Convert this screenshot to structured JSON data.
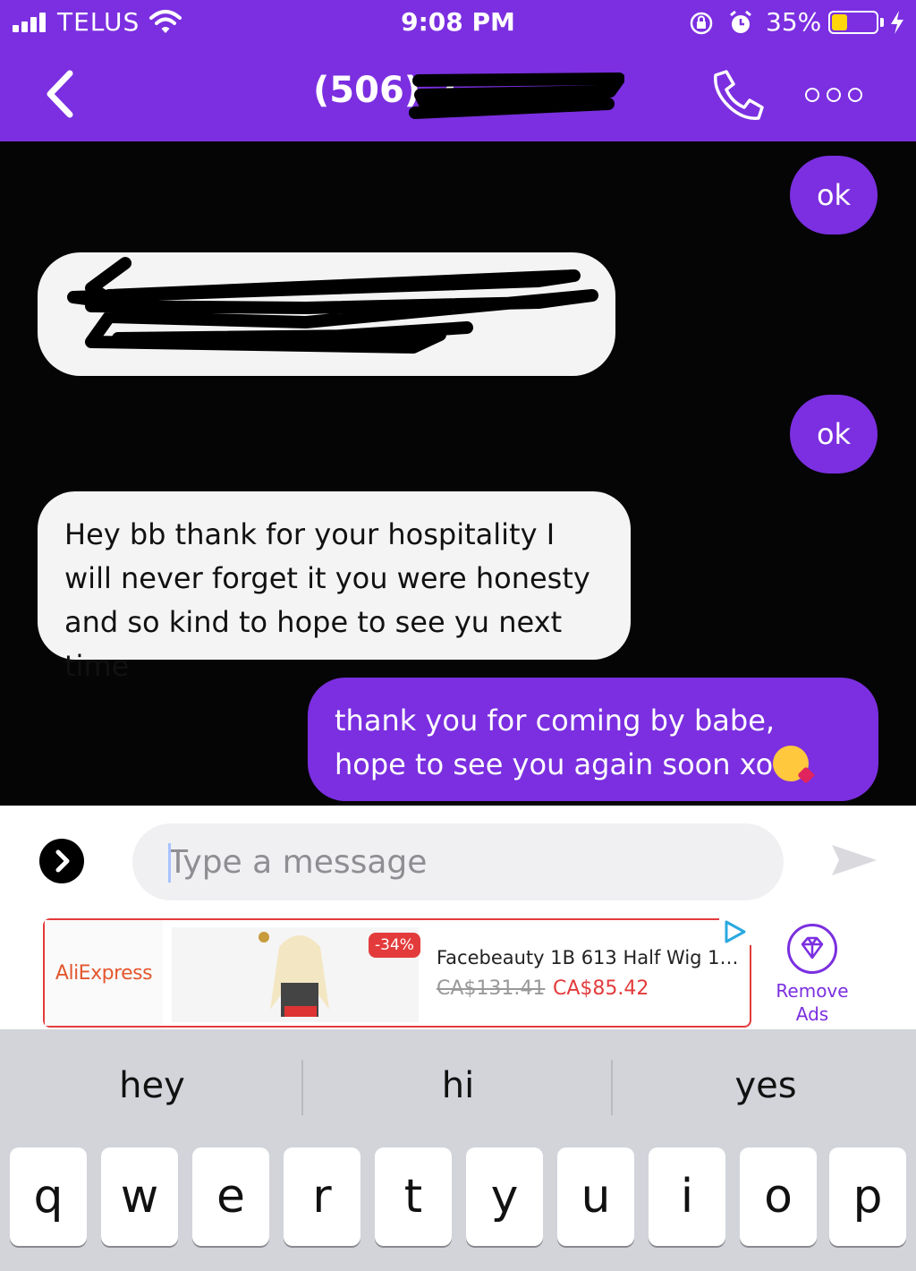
{
  "status_bar": {
    "carrier": "TELUS",
    "time": "9:08 PM",
    "battery_percent": "35%",
    "battery_level": 0.35
  },
  "header": {
    "title": "(506) 2",
    "icons": [
      "back-chevron-icon",
      "phone-icon",
      "more-icon"
    ]
  },
  "messages": [
    {
      "direction": "outgoing",
      "text": "ok"
    },
    {
      "direction": "incoming",
      "text": ""
    },
    {
      "direction": "outgoing",
      "text": "ok"
    },
    {
      "direction": "incoming",
      "text": "Hey bb thank for your hospitality I will never forget it you were honesty and so kind to hope to see yu next time"
    },
    {
      "direction": "outgoing",
      "text": "thank you for coming by babe, hope to see you again soon xo"
    }
  ],
  "composer": {
    "placeholder": "Type a message"
  },
  "ad": {
    "brand": "AliExpress",
    "discount": "-34%",
    "title": "Facebeauty 1B 613 Half Wig 15...",
    "old_price": "CA$131.41",
    "new_price": "CA$85.42",
    "remove_label_1": "Remove",
    "remove_label_2": "Ads"
  },
  "keyboard": {
    "suggestions": [
      "hey",
      "hi",
      "yes"
    ],
    "keys": [
      "q",
      "w",
      "e",
      "r",
      "t",
      "y",
      "u",
      "i",
      "o",
      "p"
    ]
  },
  "colors": {
    "accent": "#7b2fe0",
    "chat_background": "#050505",
    "incoming_bubble": "#f4f4f4",
    "ad_border": "#e33b3b"
  }
}
